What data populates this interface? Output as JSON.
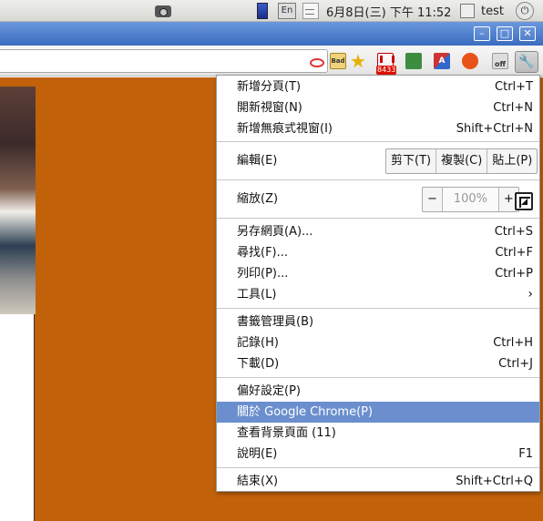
{
  "panel": {
    "clock": "6月8日(三) 下午 11:52",
    "user": "test",
    "lang": "En"
  },
  "window": {
    "minimize": "–",
    "maximize": "□",
    "close": "✕"
  },
  "toolbar": {
    "ext_bad": "Bad",
    "gmail_count": "8433",
    "translate": "A",
    "off_label": "off",
    "wrench": "🔧"
  },
  "menu": {
    "new_tab": {
      "label": "新增分頁(T)",
      "shortcut": "Ctrl+T"
    },
    "new_window": {
      "label": "開新視窗(N)",
      "shortcut": "Ctrl+N"
    },
    "new_incognito": {
      "label": "新增無痕式視窗(I)",
      "shortcut": "Shift+Ctrl+N"
    },
    "edit": {
      "label": "編輯(E)",
      "cut": "剪下(T)",
      "copy": "複製(C)",
      "paste": "貼上(P)"
    },
    "zoom": {
      "label": "縮放(Z)",
      "minus": "−",
      "level": "100%",
      "plus": "+"
    },
    "save_page": {
      "label": "另存網頁(A)...",
      "shortcut": "Ctrl+S"
    },
    "find": {
      "label": "尋找(F)...",
      "shortcut": "Ctrl+F"
    },
    "print": {
      "label": "列印(P)...",
      "shortcut": "Ctrl+P"
    },
    "tools": {
      "label": "工具(L)",
      "arrow": "›"
    },
    "bookmarks": {
      "label": "書籤管理員(B)"
    },
    "history": {
      "label": "記錄(H)",
      "shortcut": "Ctrl+H"
    },
    "downloads": {
      "label": "下載(D)",
      "shortcut": "Ctrl+J"
    },
    "preferences": {
      "label": "偏好設定(P)"
    },
    "about": {
      "label": "關於 Google Chrome(P)"
    },
    "background_pages": {
      "label": "查看背景頁面 (11)"
    },
    "help": {
      "label": "說明(E)",
      "shortcut": "F1"
    },
    "exit": {
      "label": "結束(X)",
      "shortcut": "Shift+Ctrl+Q"
    }
  },
  "colors": {
    "page_bg": "#c1610a",
    "highlight": "#6b8fce",
    "titlebar": "#4a7bcc"
  }
}
